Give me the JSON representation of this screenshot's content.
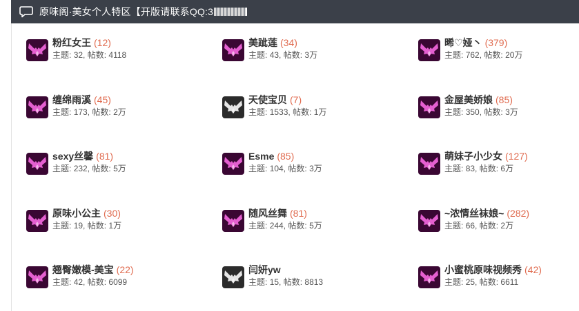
{
  "header": {
    "title": "原味阁·美女个人特区【开版请联系QQ:3",
    "icon": "chat-bubble-icon"
  },
  "forums": [
    {
      "name": "粉红女王",
      "count": "(12)",
      "topics_label": "主题",
      "topics": "32",
      "posts_label": "帖数",
      "posts": "4118",
      "icon": "pink-wings-icon"
    },
    {
      "name": "美跐莲",
      "count": "(34)",
      "topics_label": "主题",
      "topics": "43",
      "posts_label": "帖数",
      "posts": "3万",
      "icon": "pink-wings-icon"
    },
    {
      "name": "晞♡娅丶",
      "count": "(379)",
      "topics_label": "主题",
      "topics": "762",
      "posts_label": "帖数",
      "posts": "20万",
      "icon": "pink-wings-icon"
    },
    {
      "name": "缠绵雨溪",
      "count": "(45)",
      "topics_label": "主题",
      "topics": "173",
      "posts_label": "帖数",
      "posts": "2万",
      "icon": "pink-wings-icon"
    },
    {
      "name": "天使宝贝",
      "count": "(7)",
      "topics_label": "主题",
      "topics": "1533",
      "posts_label": "帖数",
      "posts": "1万",
      "icon": "white-wings-icon"
    },
    {
      "name": "金屋美娇娘",
      "count": "(85)",
      "topics_label": "主题",
      "topics": "350",
      "posts_label": "帖数",
      "posts": "3万",
      "icon": "pink-wings-icon"
    },
    {
      "name": "sexy丝馨",
      "count": "(81)",
      "topics_label": "主题",
      "topics": "232",
      "posts_label": "帖数",
      "posts": "5万",
      "icon": "pink-wings-icon"
    },
    {
      "name": "Esme",
      "count": "(85)",
      "topics_label": "主题",
      "topics": "104",
      "posts_label": "帖数",
      "posts": "3万",
      "icon": "pink-wings-icon"
    },
    {
      "name": "萌妹子小少女",
      "count": "(127)",
      "topics_label": "主题",
      "topics": "83",
      "posts_label": "帖数",
      "posts": "6万",
      "icon": "pink-wings-icon"
    },
    {
      "name": "原味小公主",
      "count": "(30)",
      "topics_label": "主题",
      "topics": "19",
      "posts_label": "帖数",
      "posts": "1万",
      "icon": "pink-wings-icon"
    },
    {
      "name": "随风丝舞",
      "count": "(81)",
      "topics_label": "主题",
      "topics": "244",
      "posts_label": "帖数",
      "posts": "5万",
      "icon": "pink-wings-icon"
    },
    {
      "name": "~浓情丝袜娘~",
      "count": "(282)",
      "topics_label": "主题",
      "topics": "66",
      "posts_label": "帖数",
      "posts": "2万",
      "icon": "pink-wings-icon"
    },
    {
      "name": "翘臀嫩模-美宝",
      "count": "(22)",
      "topics_label": "主题",
      "topics": "42",
      "posts_label": "帖数",
      "posts": "6099",
      "icon": "pink-wings-icon"
    },
    {
      "name": "闫妍yw",
      "count": "",
      "topics_label": "主题",
      "topics": "15",
      "posts_label": "帖数",
      "posts": "8813",
      "icon": "white-wings-icon"
    },
    {
      "name": "小蜜桃原味视频秀",
      "count": "(42)",
      "topics_label": "主题",
      "topics": "25",
      "posts_label": "帖数",
      "posts": "6611",
      "icon": "pink-wings-icon"
    }
  ],
  "colors": {
    "header_bg": "#3b4049",
    "count": "#e06b4f",
    "name": "#333333",
    "stats": "#555555",
    "icon_pink": "#e45fd0",
    "icon_white": "#e6e6e6"
  }
}
